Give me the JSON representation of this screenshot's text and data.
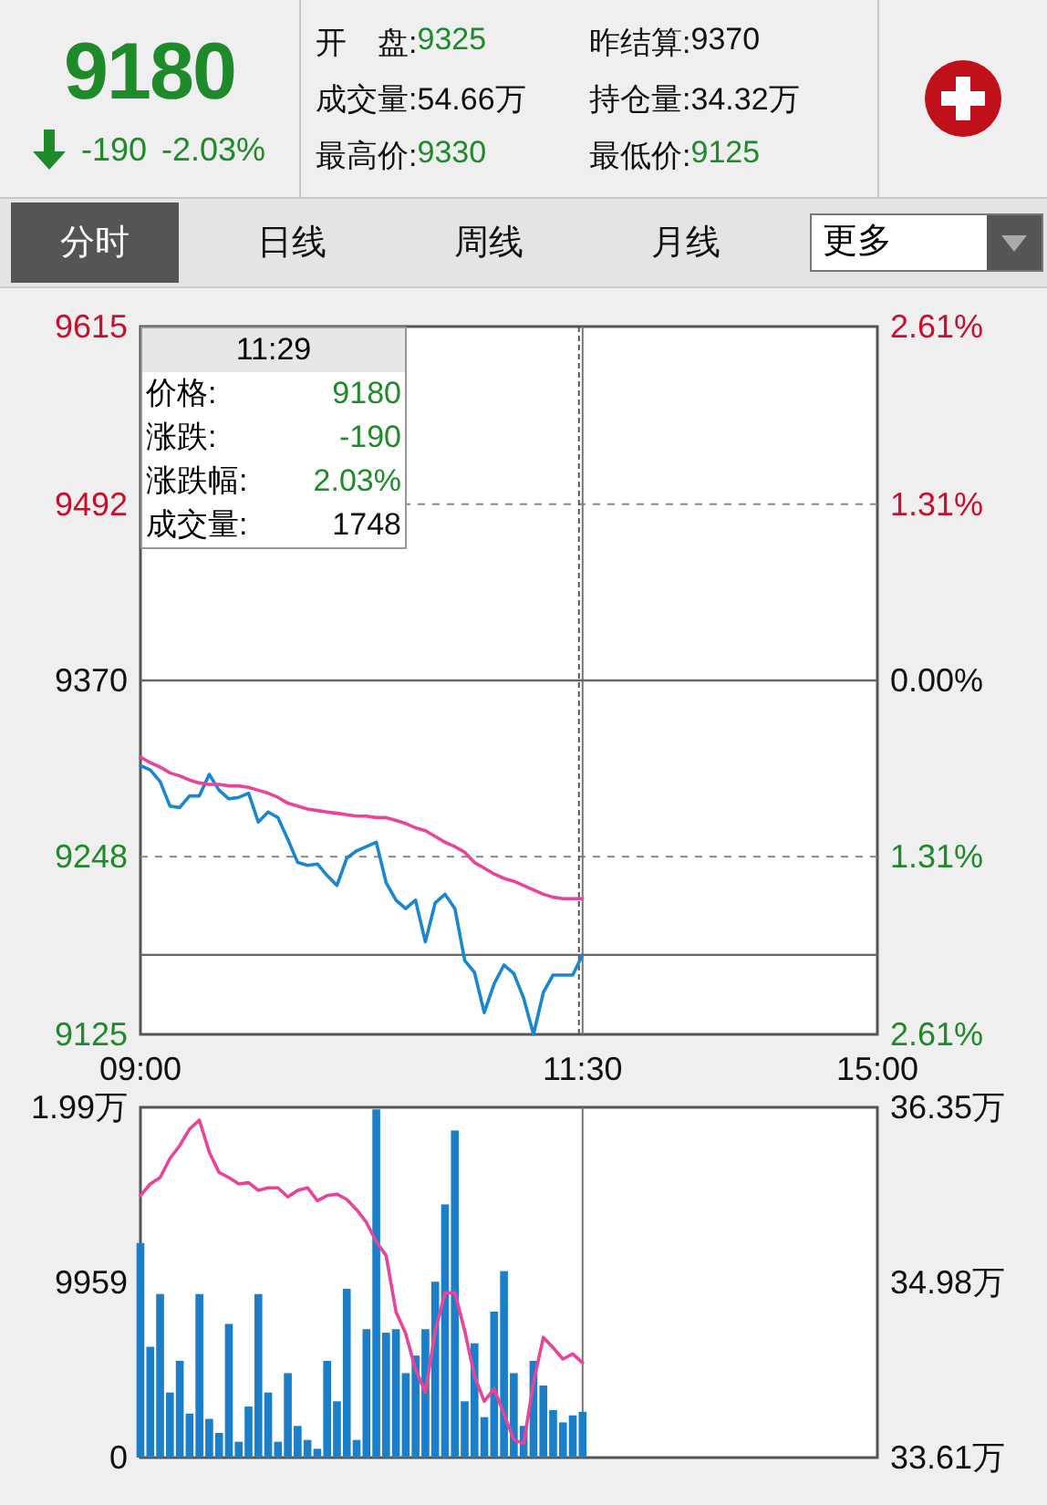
{
  "quote": {
    "price": "9180",
    "falling": true,
    "color": "#1f8a2a",
    "change": "-190",
    "change_percent": "-2.03%"
  },
  "stats": [
    {
      "label": "开　盘:",
      "value": "9325",
      "color": "#1f8a2a"
    },
    {
      "label": "昨结算:",
      "value": "9370",
      "color": "#111111"
    },
    {
      "label": "成交量:",
      "value": "54.66万",
      "color": "#111111"
    },
    {
      "label": "持仓量:",
      "value": "34.32万",
      "color": "#111111"
    },
    {
      "label": "最高价:",
      "value": "9330",
      "color": "#1f8a2a"
    },
    {
      "label": "最低价:",
      "value": "9125",
      "color": "#1f8a2a"
    }
  ],
  "tabs": [
    {
      "label": "分时",
      "selected": true
    },
    {
      "label": "日线",
      "selected": false
    },
    {
      "label": "周线",
      "selected": false
    },
    {
      "label": "月线",
      "selected": false
    }
  ],
  "more_dropdown": {
    "value": "更多"
  },
  "price_chart": {
    "tooltip": {
      "time": "11:29",
      "rows": [
        {
          "label": "价格:",
          "value": "9180",
          "color": "#1f8a2a"
        },
        {
          "label": "涨跌:",
          "value": "-190",
          "color": "#1f8a2a"
        },
        {
          "label": "涨跌幅:",
          "value": "2.03%",
          "color": "#1f8a2a"
        },
        {
          "label": "成交量:",
          "value": "1748",
          "color": "#111111"
        }
      ]
    },
    "right_axis": [
      {
        "label": "2.61%",
        "color": "#c8102e"
      },
      {
        "label": "1.31%",
        "color": "#c8102e"
      },
      {
        "label": "0.00%",
        "color": "#111111"
      },
      {
        "label": "1.31%",
        "color": "#1f8a2a"
      },
      {
        "label": "2.61%",
        "color": "#1f8a2a"
      }
    ],
    "chart_data": {
      "type": "line",
      "categories": [
        "09:00",
        null,
        null,
        null,
        null,
        null,
        null,
        null,
        null,
        null,
        null,
        null,
        null,
        null,
        null,
        null,
        null,
        null,
        null,
        null,
        null,
        null,
        null,
        null,
        null,
        null,
        null,
        null,
        null,
        null,
        null,
        null,
        null,
        null,
        null,
        null,
        null,
        null,
        null,
        null,
        null,
        null,
        null,
        null,
        null,
        "11:30",
        null,
        null,
        null,
        null,
        null,
        null,
        null,
        null,
        null,
        null,
        null,
        null,
        null,
        null,
        null,
        null,
        null,
        null,
        null,
        null,
        null,
        null,
        null,
        null,
        null,
        null,
        null,
        null,
        null,
        "15:00"
      ],
      "series": [
        {
          "color": "#1a86d0",
          "values": [
            9311,
            9308,
            9300,
            9283,
            9282,
            9290,
            9290,
            9305,
            9294,
            9288,
            9289,
            9292,
            9272,
            9279,
            9275,
            9260,
            9244,
            9242,
            9243,
            9235,
            9228,
            9247,
            9252,
            9255,
            9258,
            9230,
            9218,
            9212,
            9218,
            9189,
            9216,
            9222,
            9212,
            9176,
            9168,
            9140,
            9160,
            9173,
            9167,
            9150,
            9125,
            9154,
            9166,
            9166,
            9166,
            9180,
            null,
            null,
            null,
            null,
            null,
            null,
            null,
            null,
            null,
            null,
            null,
            null,
            null,
            null,
            null,
            null,
            null,
            null,
            null,
            null,
            null,
            null,
            null,
            null,
            null,
            null,
            null,
            null,
            null,
            null
          ]
        },
        {
          "color": "#e8459a",
          "values": [
            9317,
            9313,
            9310,
            9306,
            9304,
            9301,
            9299,
            9298,
            9298,
            9297,
            9297,
            9296,
            9294,
            9292,
            9289,
            9285,
            9283,
            9281,
            9280,
            9279,
            9278,
            9277,
            9276,
            9276,
            9275,
            9275,
            9273,
            9271,
            9268,
            9266,
            9262,
            9258,
            9255,
            9251,
            9244,
            9240,
            9236,
            9233,
            9231,
            9228,
            9225,
            9222,
            9220,
            9219,
            9219,
            9219,
            null,
            null,
            null,
            null,
            null,
            null,
            null,
            null,
            null,
            null,
            null,
            null,
            null,
            null,
            null,
            null,
            null,
            null,
            null,
            null,
            null,
            null,
            null,
            null,
            null,
            null,
            null,
            null,
            null,
            null
          ]
        }
      ],
      "ylim": [
        9125,
        9615
      ],
      "yticks": [
        {
          "value": 9125,
          "label": "9125"
        },
        {
          "value": 9248,
          "label": "9248"
        },
        {
          "value": 9370,
          "label": "9370"
        },
        {
          "value": 9492,
          "label": "9492"
        },
        {
          "value": 9615,
          "label": "9615"
        }
      ],
      "grid": true,
      "ref_lines": [
        {
          "axis": "y",
          "value": 9370
        },
        {
          "axis": "y",
          "value": 9180
        }
      ]
    }
  },
  "volume_chart": {
    "chart_data": {
      "type": "bar",
      "categories": [
        null,
        null,
        null,
        null,
        null,
        null,
        null,
        null,
        null,
        null,
        null,
        null,
        null,
        null,
        null,
        null,
        null,
        null,
        null,
        null,
        null,
        null,
        null,
        null,
        null,
        null,
        null,
        null,
        null,
        null,
        null,
        null,
        null,
        null,
        null,
        null,
        null,
        null,
        null,
        null,
        null,
        null,
        null,
        null,
        null,
        null,
        null,
        null,
        null,
        null,
        null,
        null,
        null,
        null,
        null,
        null,
        null,
        null,
        null,
        null,
        null,
        null,
        null,
        null,
        null,
        null,
        null,
        null,
        null,
        null,
        null,
        null,
        null,
        null,
        null,
        null
      ],
      "series": [
        {
          "color": "#1a7fc8",
          "values": [
            12200,
            6300,
            9300,
            3700,
            5500,
            2500,
            9300,
            2200,
            1400,
            7600,
            900,
            2900,
            9300,
            3700,
            900,
            4800,
            1800,
            1000,
            500,
            5500,
            3200,
            9600,
            1000,
            7300,
            19800,
            7100,
            7300,
            4800,
            5800,
            7300,
            10000,
            14400,
            18600,
            3200,
            6500,
            2300,
            8300,
            10600,
            4800,
            1800,
            5500,
            4100,
            2700,
            2000,
            2400,
            2600,
            null,
            null,
            null,
            null,
            null,
            null,
            null,
            null,
            null,
            null,
            null,
            null,
            null,
            null,
            null,
            null,
            null,
            null,
            null,
            null,
            null,
            null,
            null,
            null,
            null,
            null,
            null,
            null,
            null,
            null
          ]
        }
      ],
      "ylim": [
        0,
        19918
      ],
      "yticks": [
        {
          "value": 0,
          "label": "0"
        },
        {
          "value": 9959,
          "label": "9959"
        }
      ]
    },
    "max_label": "1.99万"
  },
  "open_interest_chart": {
    "chart_data": {
      "type": "line",
      "categories": [
        null,
        null,
        null,
        null,
        null,
        null,
        null,
        null,
        null,
        null,
        null,
        null,
        null,
        null,
        null,
        null,
        null,
        null,
        null,
        null,
        null,
        null,
        null,
        null,
        null,
        null,
        null,
        null,
        null,
        null,
        null,
        null,
        null,
        null,
        null,
        null,
        null,
        null,
        null,
        null,
        null,
        null,
        null,
        null,
        null,
        null,
        null,
        null,
        null,
        null,
        null,
        null,
        null,
        null,
        null,
        null,
        null,
        null,
        null,
        null,
        null,
        null,
        null,
        null,
        null,
        null,
        null,
        null,
        null,
        null,
        null,
        null,
        null,
        null,
        null,
        null
      ],
      "series": [
        {
          "color": "#e8459a",
          "values": [
            35.66,
            35.75,
            35.8,
            35.95,
            36.05,
            36.18,
            36.25,
            36.0,
            35.84,
            35.8,
            35.75,
            35.76,
            35.7,
            35.72,
            35.72,
            35.65,
            35.7,
            35.72,
            35.62,
            35.66,
            35.67,
            35.63,
            35.55,
            35.45,
            35.3,
            35.19,
            34.75,
            34.58,
            34.3,
            34.12,
            34.6,
            34.9,
            34.9,
            34.6,
            34.25,
            34.05,
            34.15,
            33.95,
            33.75,
            33.72,
            34.2,
            34.55,
            34.47,
            34.38,
            34.42,
            34.35,
            null,
            null,
            null,
            null,
            null,
            null,
            null,
            null,
            null,
            null,
            null,
            null,
            null,
            null,
            null,
            null,
            null,
            null,
            null,
            null,
            null,
            null,
            null,
            null,
            null,
            null,
            null,
            null,
            null,
            null
          ]
        }
      ],
      "ylim": [
        33.61,
        36.35
      ],
      "yticks": [
        {
          "value": 33.61,
          "label": "33.61万"
        },
        {
          "value": 34.98,
          "label": "34.98万"
        },
        {
          "value": 36.35,
          "label": "36.35万"
        }
      ]
    }
  }
}
